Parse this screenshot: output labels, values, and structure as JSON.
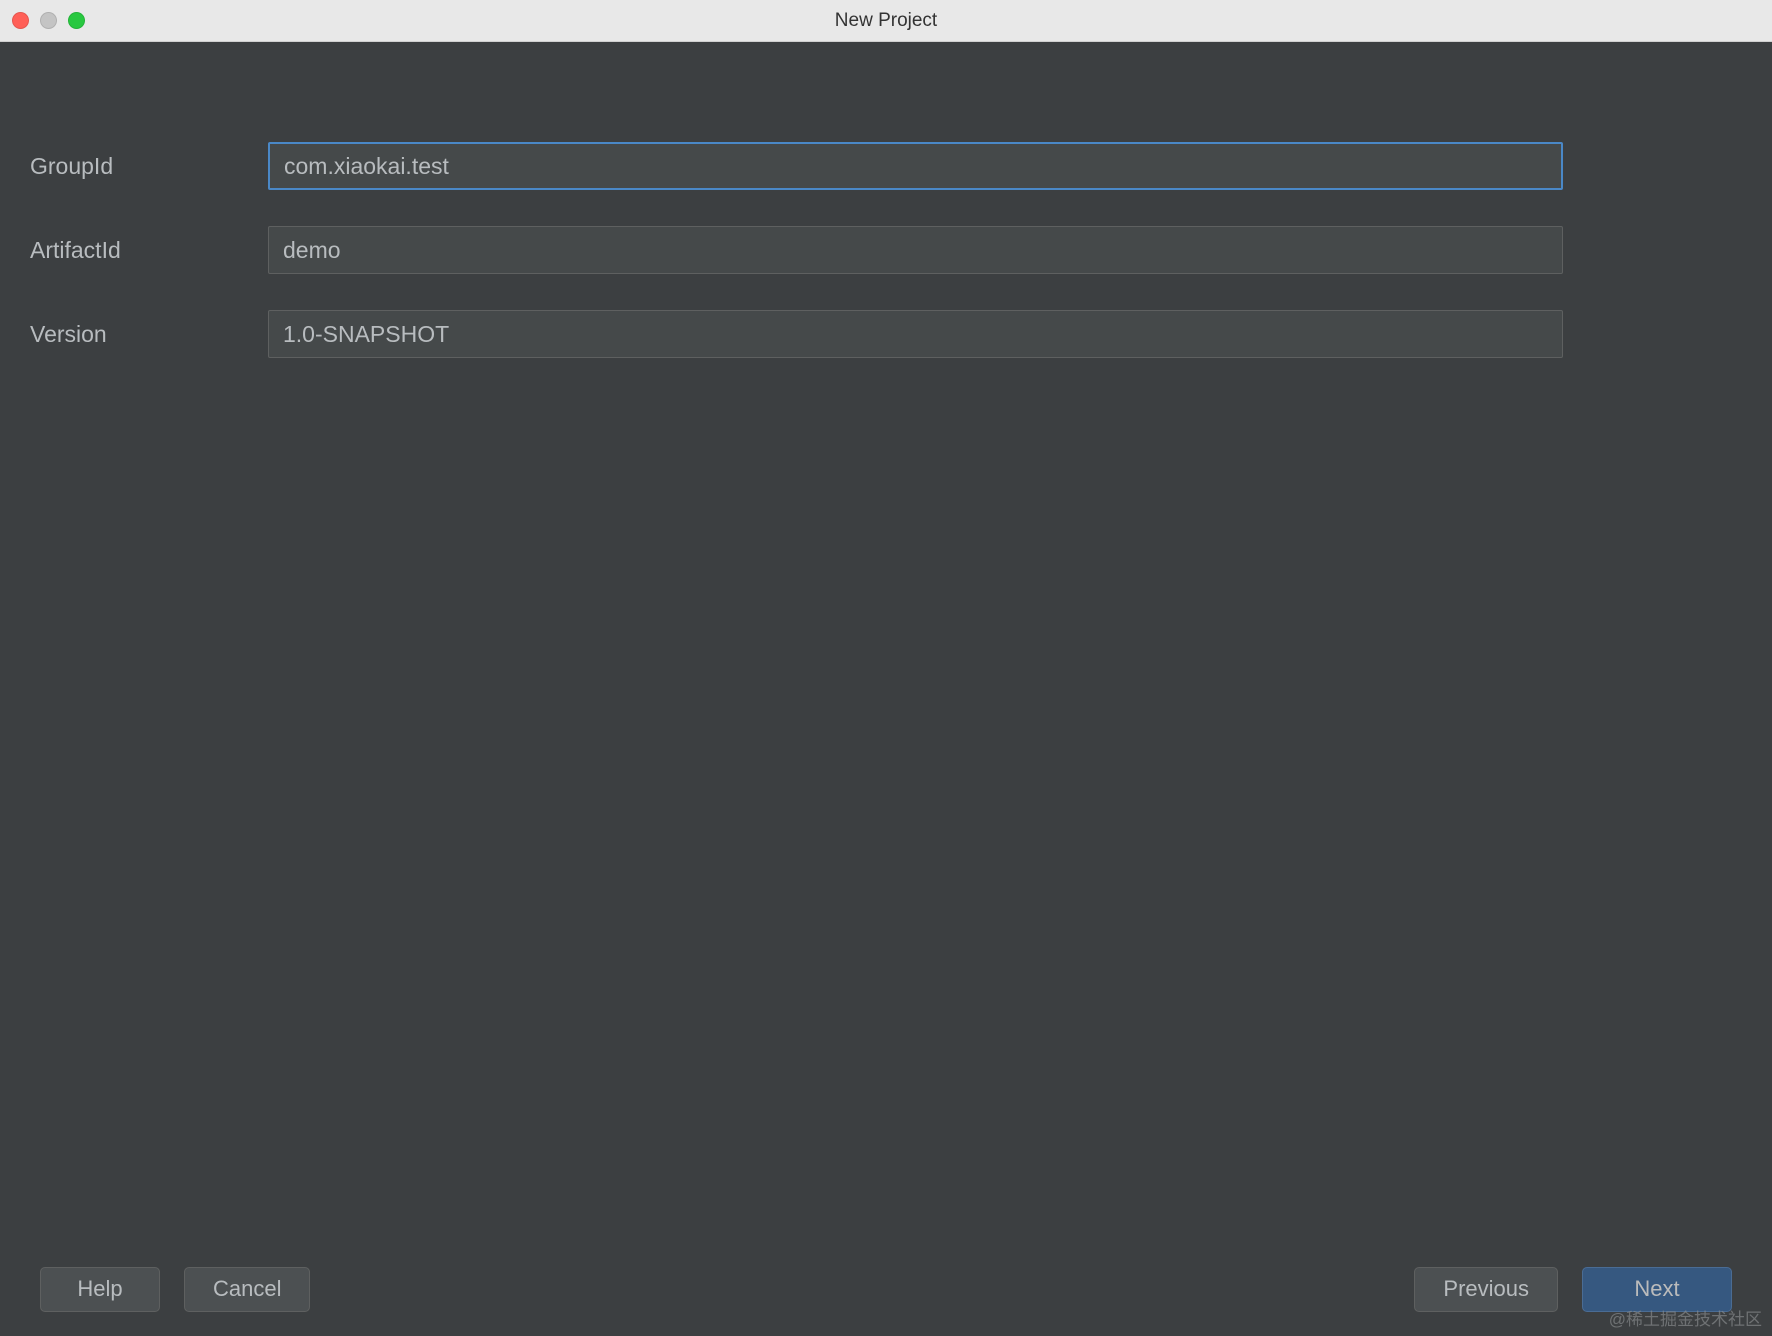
{
  "window": {
    "title": "New Project"
  },
  "form": {
    "groupId": {
      "label": "GroupId",
      "value": "com.xiaokai.test"
    },
    "artifactId": {
      "label": "ArtifactId",
      "value": "demo"
    },
    "version": {
      "label": "Version",
      "value": "1.0-SNAPSHOT"
    }
  },
  "buttons": {
    "help": "Help",
    "cancel": "Cancel",
    "previous": "Previous",
    "next": "Next"
  },
  "watermark": "@稀土掘金技术社区"
}
